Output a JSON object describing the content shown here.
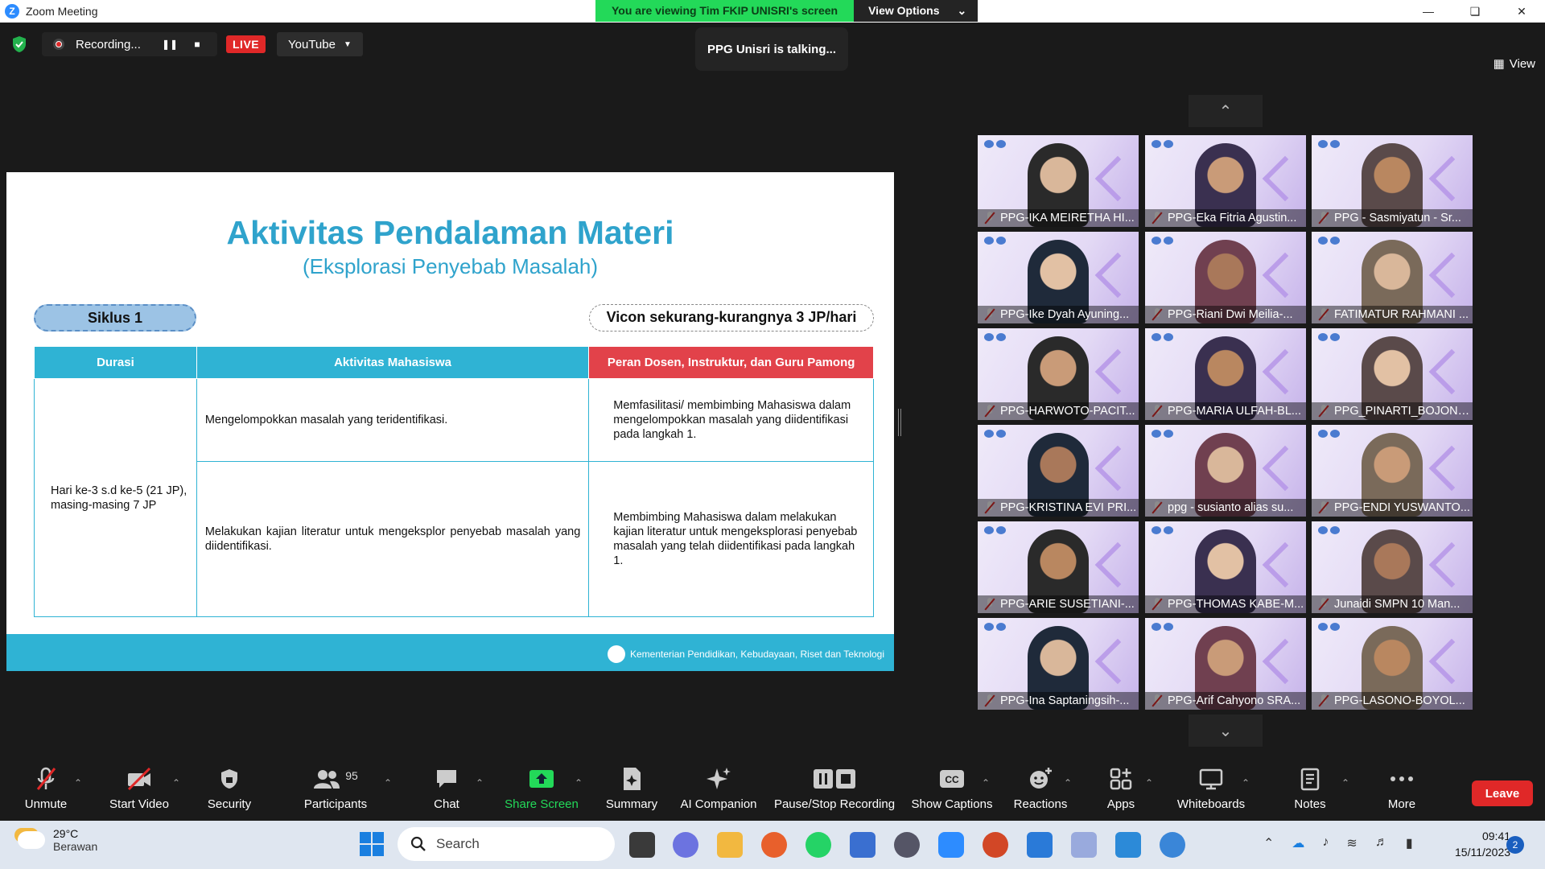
{
  "window": {
    "title": "Zoom Meeting",
    "banner": "You are viewing Tim FKIP UNISRI's screen",
    "view_options": "View Options"
  },
  "topbar": {
    "recording": "Recording...",
    "live": "LIVE",
    "stream_target": "YouTube",
    "talking": "PPG Unisri is talking...",
    "view": "View"
  },
  "slide": {
    "title": "Aktivitas Pendalaman Materi",
    "subtitle": "(Eksplorasi Penyebab Masalah)",
    "siklus": "Siklus 1",
    "vicon": "Vicon sekurang-kurangnya 3 JP/hari",
    "headers": [
      "Durasi",
      "Aktivitas Mahasiswa",
      "Peran Dosen, Instruktur, dan Guru Pamong"
    ],
    "durasi": "Hari ke-3 s.d ke-5 (21 JP), masing-masing 7 JP",
    "rows": [
      {
        "aktivitas": "Mengelompokkan masalah yang teridentifikasi.",
        "peran": "Memfasilitasi/ membimbing Mahasiswa dalam mengelompokkan masalah yang diidentifikasi pada langkah 1."
      },
      {
        "aktivitas": "Melakukan kajian literatur untuk mengeksplor penyebab masalah yang diidentifikasi.",
        "peran": "Membimbing Mahasiswa dalam melakukan kajian literatur untuk mengeksplorasi penyebab masalah yang telah diidentifikasi pada langkah 1."
      }
    ],
    "footer": "Kementerian Pendidikan, Kebudayaan, Riset dan Teknologi"
  },
  "participants": [
    "PPG-IKA MEIRETHA HI...",
    "PPG-Eka Fitria Agustin...",
    "PPG - Sasmiyatun - Sr...",
    "PPG-Ike Dyah Ayuning...",
    "PPG-Riani Dwi Meilia-...",
    "FATIMATUR RAHMANI ...",
    "PPG-HARWOTO-PACIT...",
    "PPG-MARIA ULFAH-BL...",
    "PPG_PINARTI_BOJONE...",
    "PPG-KRISTINA EVI PRI...",
    "ppg - susianto alias su...",
    "PPG-ENDI YUSWANTO...",
    "PPG-ARIE SUSETIANI-...",
    "PPG-THOMAS KABE-M...",
    "Junaidi SMPN 10 Man...",
    "PPG-Ina Saptaningsih-...",
    "PPG-Arif Cahyono SRA...",
    "PPG-LASONO-BOYOL..."
  ],
  "toolbar": {
    "unmute": "Unmute",
    "start_video": "Start Video",
    "security": "Security",
    "participants": "Participants",
    "participant_count": "95",
    "chat": "Chat",
    "share_screen": "Share Screen",
    "summary": "Summary",
    "ai_companion": "AI Companion",
    "pause_stop": "Pause/Stop Recording",
    "show_captions": "Show Captions",
    "reactions": "Reactions",
    "apps": "Apps",
    "whiteboards": "Whiteboards",
    "notes": "Notes",
    "more": "More",
    "leave": "Leave"
  },
  "taskbar": {
    "temp": "29°C",
    "weather": "Berawan",
    "search": "Search",
    "time": "09:41",
    "date": "15/11/2023",
    "notifications": "2"
  },
  "icons": [
    "zoom-logo-icon",
    "shield-icon",
    "pause-icon",
    "stop-icon",
    "chevron-down-icon",
    "view-icon",
    "chevron-up-icon",
    "mic-muted-icon",
    "video-off-icon",
    "security-icon",
    "participants-icon",
    "chat-icon",
    "share-screen-icon",
    "summary-icon",
    "ai-companion-icon",
    "pause-stop-icon",
    "cc-icon",
    "reactions-icon",
    "apps-icon",
    "whiteboard-icon",
    "notes-icon",
    "more-icon",
    "windows-start-icon",
    "search-icon"
  ]
}
